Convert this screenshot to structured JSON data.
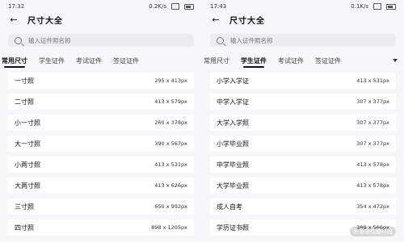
{
  "left": {
    "status": {
      "time": "17:32",
      "net": "0.2K/s"
    },
    "title": "尺寸大全",
    "search_placeholder": "输入证件照名称",
    "tabs": [
      "常用尺寸",
      "学生证件",
      "考试证件",
      "签证证件"
    ],
    "active_tab": 0,
    "rows": [
      {
        "name": "一寸照",
        "size": "295 x 413px"
      },
      {
        "name": "二寸照",
        "size": "413 x 579px"
      },
      {
        "name": "小一寸照",
        "size": "260 x 378px"
      },
      {
        "name": "大一寸照",
        "size": "390 x 567px"
      },
      {
        "name": "小两寸照",
        "size": "413 x 531px"
      },
      {
        "name": "大两寸照",
        "size": "413 x 626px"
      },
      {
        "name": "三寸照",
        "size": "650 x 992px"
      },
      {
        "name": "四寸照",
        "size": "898 x 1205px"
      }
    ]
  },
  "right": {
    "status": {
      "time": "17:43",
      "net": "0.1K/s"
    },
    "title": "尺寸大全",
    "search_placeholder": "输入证件照名称",
    "tabs": [
      "常用尺寸",
      "学生证件",
      "考试证件",
      "签证证件"
    ],
    "active_tab": 1,
    "rows": [
      {
        "name": "小学入学证",
        "size": "413 x 531px"
      },
      {
        "name": "中学入学证",
        "size": "307 x 377px"
      },
      {
        "name": "大学入学照",
        "size": "307 x 377px"
      },
      {
        "name": "小学毕业照",
        "size": "307 x 377px"
      },
      {
        "name": "中学毕业照",
        "size": "413 x 578px"
      },
      {
        "name": "大学毕业照",
        "size": "413 x 578px"
      },
      {
        "name": "成人自考",
        "size": "354 x 472px"
      },
      {
        "name": "学历证书照",
        "size": "389 x 566px"
      }
    ],
    "watermark": "头条@花瓣科技"
  }
}
